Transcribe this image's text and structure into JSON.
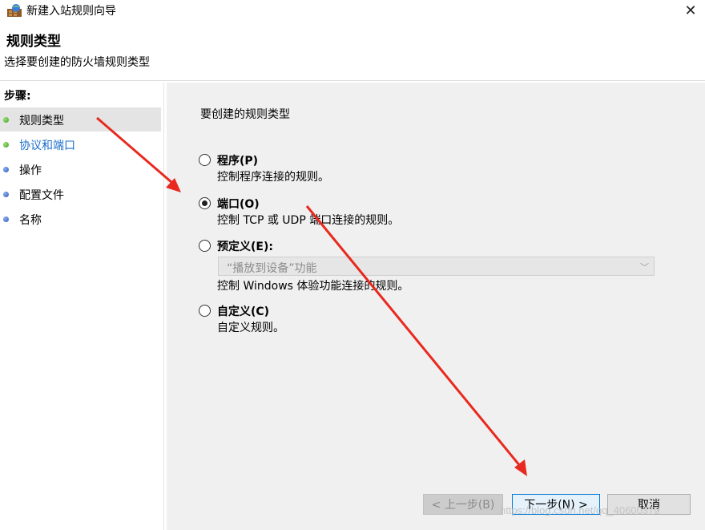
{
  "window": {
    "title": "新建入站规则向导",
    "close_symbol": "✕"
  },
  "header": {
    "title": "规则类型",
    "subtitle": "选择要创建的防火墙规则类型"
  },
  "sidebar": {
    "steps_label": "步骤:",
    "steps": [
      {
        "label": "规则类型",
        "state": "current"
      },
      {
        "label": "协议和端口",
        "state": "link"
      },
      {
        "label": "操作",
        "state": "normal"
      },
      {
        "label": "配置文件",
        "state": "normal"
      },
      {
        "label": "名称",
        "state": "normal"
      }
    ]
  },
  "main": {
    "question": "要创建的规则类型",
    "options": {
      "program": {
        "label": "程序(P)",
        "description": "控制程序连接的规则。",
        "selected": false
      },
      "port": {
        "label": "端口(O)",
        "description": "控制 TCP 或 UDP 端口连接的规则。",
        "selected": true
      },
      "predefined": {
        "label": "预定义(E):",
        "select_value": "“播放到设备”功能",
        "description": "控制 Windows 体验功能连接的规则。",
        "selected": false
      },
      "custom": {
        "label": "自定义(C)",
        "description": "自定义规则。",
        "selected": false
      }
    }
  },
  "buttons": {
    "back": "< 上一步(B)",
    "next": "下一步(N) >",
    "cancel": "取消"
  },
  "watermark": "https://blog.csdn.net/qq_40600379",
  "colors": {
    "arrow": "#e8291f",
    "next_border": "#0078d7",
    "link": "#1a6fc9"
  }
}
